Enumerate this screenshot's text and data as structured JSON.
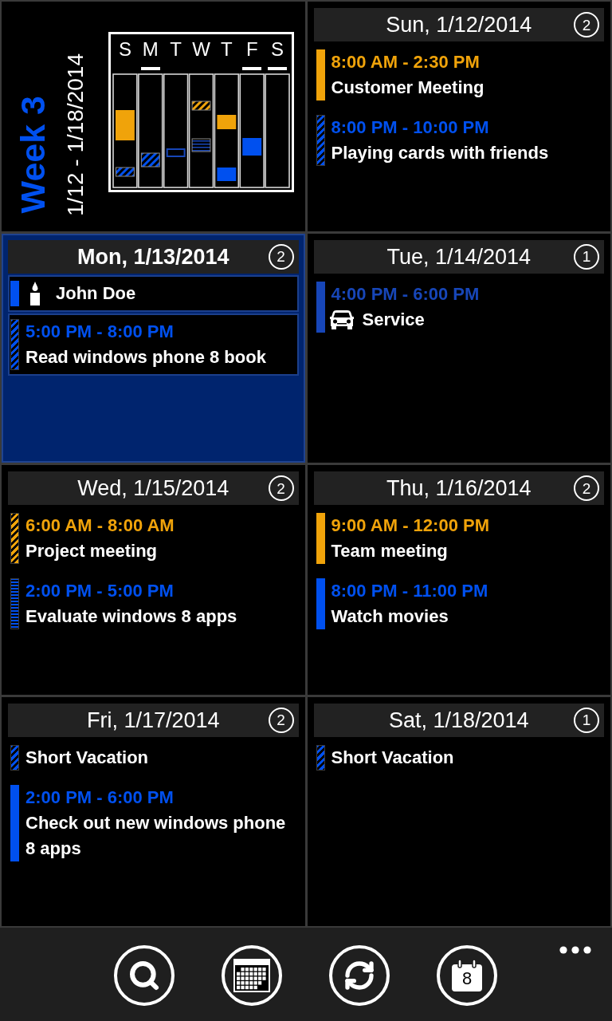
{
  "week": {
    "title": "Week 3",
    "range": "1/12 - 1/18/2014",
    "days": [
      {
        "letter": "S",
        "all_day": false
      },
      {
        "letter": "M",
        "all_day": true
      },
      {
        "letter": "T",
        "all_day": false
      },
      {
        "letter": "W",
        "all_day": false
      },
      {
        "letter": "T",
        "all_day": false
      },
      {
        "letter": "F",
        "all_day": true
      },
      {
        "letter": "S",
        "all_day": true
      }
    ]
  },
  "days": [
    {
      "title": "Sun, 1/12/2014",
      "count": "2",
      "selected": false,
      "events": [
        {
          "kind": "appointment",
          "tentative": false,
          "free": false,
          "color": "#f0a30a",
          "time": "8:00 AM - 2:30 PM",
          "title": "Customer Meeting"
        },
        {
          "kind": "appointment",
          "tentative": true,
          "free": false,
          "color": "#0050ef",
          "time": "8:00 PM - 10:00 PM",
          "title": "Playing cards with friends"
        }
      ]
    },
    {
      "title": "Mon, 1/13/2014",
      "count": "2",
      "selected": true,
      "events": [
        {
          "kind": "birthday",
          "tentative": false,
          "free": false,
          "color": "#0050ef",
          "title": "John Doe"
        },
        {
          "kind": "appointment",
          "tentative": true,
          "free": false,
          "color": "#0050ef",
          "time": "5:00 PM - 8:00 PM",
          "title": "Read windows phone 8 book"
        }
      ]
    },
    {
      "title": "Tue, 1/14/2014",
      "count": "1",
      "selected": false,
      "events": [
        {
          "kind": "vehicle",
          "tentative": false,
          "free": false,
          "color": "#1746b8",
          "time": "4:00 PM - 6:00 PM",
          "title": "Service"
        }
      ]
    },
    {
      "title": "Wed, 1/15/2014",
      "count": "2",
      "selected": false,
      "events": [
        {
          "kind": "appointment",
          "tentative": true,
          "free": false,
          "color": "#f0a30a",
          "time": "6:00 AM - 8:00 AM",
          "title": "Project meeting"
        },
        {
          "kind": "appointment",
          "tentative": false,
          "free": true,
          "color": "#0050ef",
          "time": "2:00 PM - 5:00 PM",
          "title": "Evaluate windows 8 apps"
        }
      ]
    },
    {
      "title": "Thu, 1/16/2014",
      "count": "2",
      "selected": false,
      "events": [
        {
          "kind": "appointment",
          "tentative": false,
          "free": false,
          "color": "#f0a30a",
          "time": "9:00 AM - 12:00 PM",
          "title": "Team meeting"
        },
        {
          "kind": "appointment",
          "tentative": false,
          "free": false,
          "color": "#0050ef",
          "time": "8:00 PM - 11:00 PM",
          "title": "Watch movies"
        }
      ]
    },
    {
      "title": "Fri, 1/17/2014",
      "count": "2",
      "selected": false,
      "events": [
        {
          "kind": "appointment",
          "tentative": true,
          "free": false,
          "color": "#0050ef",
          "title": "Short Vacation"
        },
        {
          "kind": "appointment",
          "tentative": false,
          "free": false,
          "color": "#0050ef",
          "time": "2:00 PM - 6:00 PM",
          "title": "Check out new windows phone 8 apps"
        }
      ]
    },
    {
      "title": "Sat, 1/18/2014",
      "count": "1",
      "selected": false,
      "events": [
        {
          "kind": "appointment",
          "tentative": true,
          "free": false,
          "color": "#0050ef",
          "title": "Short Vacation"
        }
      ]
    }
  ],
  "app_bar": {
    "buttons": [
      {
        "kind": "search"
      },
      {
        "kind": "month"
      },
      {
        "kind": "sync"
      },
      {
        "kind": "today",
        "label": "8"
      }
    ]
  }
}
